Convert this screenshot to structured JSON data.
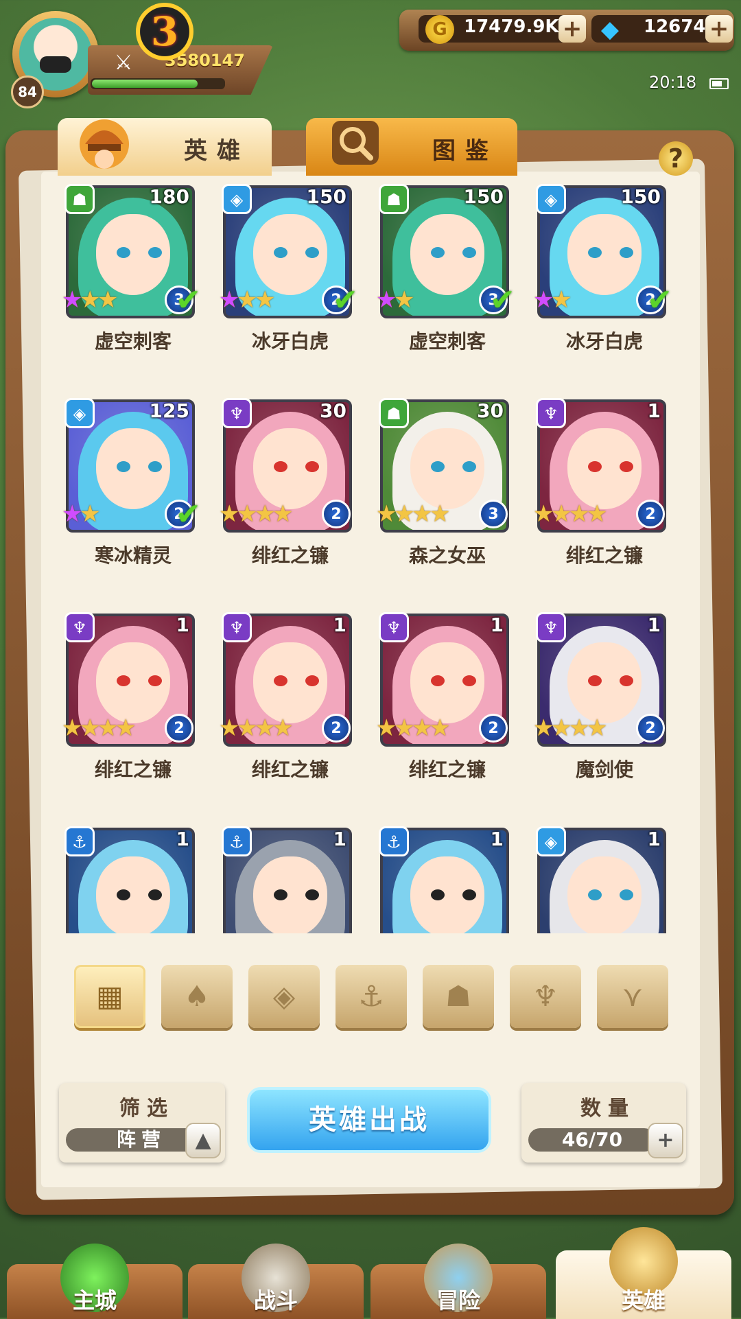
{
  "player": {
    "level": "84",
    "vip": "3",
    "power": "3580147",
    "exp_fraction": 0.8
  },
  "resources": {
    "gold": "17479.9K",
    "gems": "12674",
    "add": "+"
  },
  "status": {
    "time": "20:18"
  },
  "tabs": {
    "hero": "英雄",
    "atlas": "图鉴",
    "help": "?"
  },
  "heroes": [
    {
      "name": "虚空刺客",
      "level": "180",
      "stars": 3,
      "rank": "3",
      "camp": "beast",
      "deployed": true,
      "hair": "#3fbf9c",
      "bg": "#2c6a3a"
    },
    {
      "name": "冰牙白虎",
      "level": "150",
      "stars": 3,
      "rank": "2",
      "camp": "ice",
      "deployed": true,
      "hair": "#66d8f0",
      "bg": "#2a3f7a"
    },
    {
      "name": "虚空刺客",
      "level": "150",
      "stars": 2,
      "rank": "3",
      "camp": "beast",
      "deployed": true,
      "hair": "#3fbf9c",
      "bg": "#2c6a3a"
    },
    {
      "name": "冰牙白虎",
      "level": "150",
      "stars": 2,
      "rank": "2",
      "camp": "ice",
      "deployed": true,
      "hair": "#66d8f0",
      "bg": "#2a3f7a"
    },
    {
      "name": "寒冰精灵",
      "level": "125",
      "stars": 2,
      "rank": "2",
      "camp": "ice",
      "deployed": true,
      "hair": "#5bc9ee",
      "bg": "#5a5fd6"
    },
    {
      "name": "绯红之镰",
      "level": "30",
      "stars": 4,
      "rank": "2",
      "camp": "demon",
      "deployed": false,
      "hair": "#f2a7bd",
      "bg": "#7d2540"
    },
    {
      "name": "森之女巫",
      "level": "30",
      "stars": 4,
      "rank": "3",
      "camp": "beast",
      "deployed": false,
      "hair": "#f3f0ea",
      "bg": "#4f8a38"
    },
    {
      "name": "绯红之镰",
      "level": "1",
      "stars": 4,
      "rank": "2",
      "camp": "demon",
      "deployed": false,
      "hair": "#f2a7bd",
      "bg": "#7d2540"
    },
    {
      "name": "绯红之镰",
      "level": "1",
      "stars": 4,
      "rank": "2",
      "camp": "demon",
      "deployed": false,
      "hair": "#f2a7bd",
      "bg": "#7d2540"
    },
    {
      "name": "绯红之镰",
      "level": "1",
      "stars": 4,
      "rank": "2",
      "camp": "demon",
      "deployed": false,
      "hair": "#f2a7bd",
      "bg": "#7d2540"
    },
    {
      "name": "绯红之镰",
      "level": "1",
      "stars": 4,
      "rank": "2",
      "camp": "demon",
      "deployed": false,
      "hair": "#f2a7bd",
      "bg": "#7d2540"
    },
    {
      "name": "魔剑使",
      "level": "1",
      "stars": 4,
      "rank": "2",
      "camp": "demon",
      "deployed": false,
      "hair": "#e8e8ee",
      "bg": "#3b2b6e"
    },
    {
      "name": "",
      "level": "1",
      "stars": 0,
      "rank": "",
      "camp": "sea",
      "deployed": false,
      "hair": "#7fd2ef",
      "bg": "#264e8a"
    },
    {
      "name": "",
      "level": "1",
      "stars": 0,
      "rank": "",
      "camp": "sea",
      "deployed": false,
      "hair": "#9aa2ae",
      "bg": "#3e4d72"
    },
    {
      "name": "",
      "level": "1",
      "stars": 0,
      "rank": "",
      "camp": "sea",
      "deployed": false,
      "hair": "#7fd2ef",
      "bg": "#264e8a"
    },
    {
      "name": "",
      "level": "1",
      "stars": 0,
      "rank": "",
      "camp": "ice",
      "deployed": false,
      "hair": "#e6e6ea",
      "bg": "#2c3f6e"
    }
  ],
  "camp_filters": [
    {
      "icon": "all-camps-icon",
      "glyph": "▦",
      "active": true
    },
    {
      "icon": "forest-camp-icon",
      "glyph": "♠",
      "active": false
    },
    {
      "icon": "ice-camp-icon",
      "glyph": "◈",
      "active": false
    },
    {
      "icon": "sea-camp-icon",
      "glyph": "⚓",
      "active": false
    },
    {
      "icon": "beast-camp-icon",
      "glyph": "☗",
      "active": false
    },
    {
      "icon": "demon-camp-icon",
      "glyph": "♆",
      "active": false
    },
    {
      "icon": "dark-camp-icon",
      "glyph": "⋎",
      "active": false
    }
  ],
  "filter": {
    "label": "筛选",
    "value": "阵营"
  },
  "deploy_button": "英雄出战",
  "count": {
    "label": "数量",
    "value": "46/70"
  },
  "nav": [
    {
      "label": "主城",
      "active": false
    },
    {
      "label": "战斗",
      "active": false
    },
    {
      "label": "冒险",
      "active": false
    },
    {
      "label": "英雄",
      "active": true
    }
  ],
  "colors": {
    "beast": "#3fa63a",
    "ice": "#2f9be3",
    "demon": "#7a3cc4",
    "sea": "#2577d2"
  }
}
